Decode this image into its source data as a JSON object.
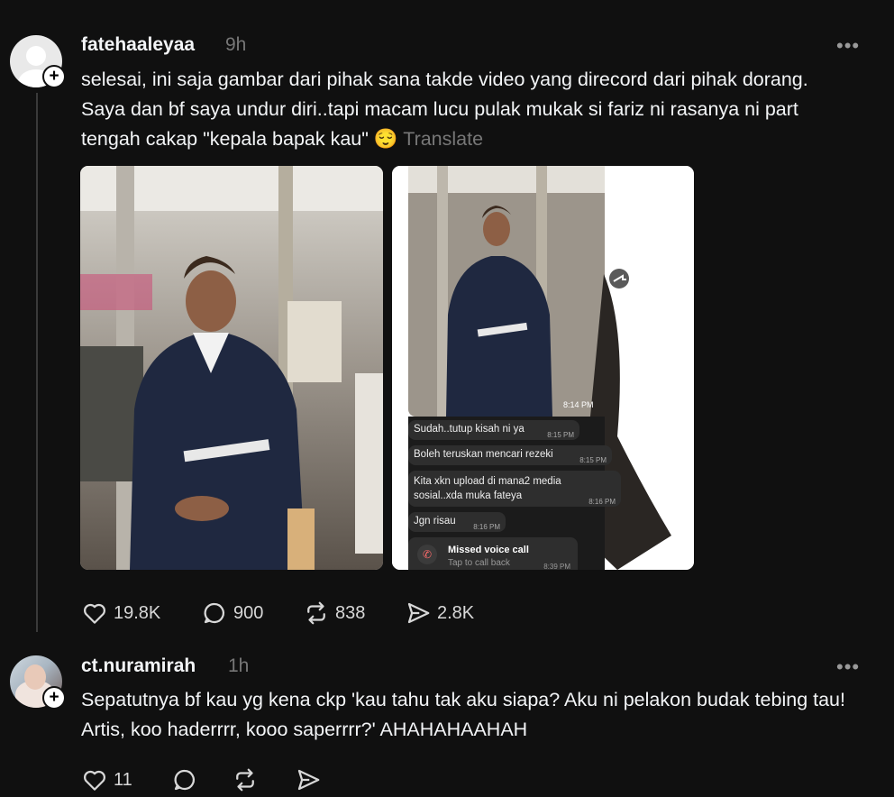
{
  "posts": [
    {
      "username": "fatehaaleyaa",
      "time": "9h",
      "text": "selesai, ini saja gambar dari pihak sana takde video yang direcord dari pihak dorang. Saya dan bf saya undur diri..tapi macam lucu pulak mukak si fariz ni rasanya ni part tengah cakap \"kepala bapak kau\" 😌",
      "translate_label": "Translate",
      "more_label": "•••",
      "media": [
        {
          "description_icon": "photo-icon"
        },
        {
          "time_stamp": "8:14 PM",
          "chat": [
            {
              "text": "Sudah..tutup kisah ni ya",
              "time": "8:15 PM"
            },
            {
              "text": "Boleh teruskan mencari rezeki",
              "time": "8:15 PM"
            },
            {
              "text": "Kita xkn upload di mana2 media sosial..xda muka fateya",
              "time": "8:16 PM"
            },
            {
              "text": "Jgn risau",
              "time": "8:16 PM"
            }
          ],
          "missed_call": {
            "title": "Missed voice call",
            "subtitle": "Tap to call back",
            "time": "8:39 PM"
          }
        }
      ],
      "likes": "19.8K",
      "comments": "900",
      "reposts": "838",
      "shares": "2.8K"
    },
    {
      "username": "ct.nuramirah",
      "time": "1h",
      "text": "Sepatutnya bf kau yg kena ckp 'kau tahu tak aku siapa? Aku ni pelakon budak tebing tau! Artis, koo haderrrr, kooo saperrrr?' AHAHAHAAHAH",
      "more_label": "•••",
      "likes": "11"
    }
  ],
  "colors": {
    "background": "#101010",
    "text": "#f3f5f7",
    "muted": "#777777"
  }
}
